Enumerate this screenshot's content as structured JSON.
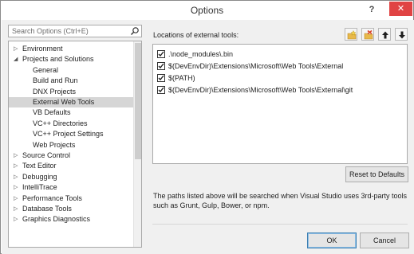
{
  "window": {
    "title": "Options",
    "help_label": "?",
    "close_label": "✕"
  },
  "search": {
    "placeholder": "Search Options (Ctrl+E)"
  },
  "tree": {
    "items": [
      {
        "label": "Environment",
        "expander": "▷"
      },
      {
        "label": "Projects and Solutions",
        "expander": "◢"
      },
      {
        "label": "General"
      },
      {
        "label": "Build and Run"
      },
      {
        "label": "DNX Projects"
      },
      {
        "label": "External Web Tools",
        "selected": true
      },
      {
        "label": "VB Defaults"
      },
      {
        "label": "VC++ Directories"
      },
      {
        "label": "VC++ Project Settings"
      },
      {
        "label": "Web Projects"
      },
      {
        "label": "Source Control",
        "expander": "▷"
      },
      {
        "label": "Text Editor",
        "expander": "▷"
      },
      {
        "label": "Debugging",
        "expander": "▷"
      },
      {
        "label": "IntelliTrace",
        "expander": "▷"
      },
      {
        "label": "Performance Tools",
        "expander": "▷"
      },
      {
        "label": "Database Tools",
        "expander": "▷"
      },
      {
        "label": "Graphics Diagnostics",
        "expander": "▷"
      }
    ]
  },
  "locations": {
    "label": "Locations of external tools:",
    "items": [
      {
        "path": ".\\node_modules\\.bin",
        "checked": true
      },
      {
        "path": "$(DevEnvDir)\\Extensions\\Microsoft\\Web Tools\\External",
        "checked": true
      },
      {
        "path": "$(PATH)",
        "checked": true
      },
      {
        "path": "$(DevEnvDir)\\Extensions\\Microsoft\\Web Tools\\External\\git",
        "checked": true
      }
    ]
  },
  "toolbar": {
    "icons": [
      "add-folder-icon",
      "remove-folder-icon",
      "move-up-icon",
      "move-down-icon"
    ]
  },
  "buttons": {
    "reset": "Reset to Defaults",
    "ok": "OK",
    "cancel": "Cancel"
  },
  "info_text": "The paths listed above will be searched when Visual Studio uses 3rd-party tools such as Grunt, Gulp, Bower, or npm.",
  "colors": {
    "close": "#e04343",
    "selected": "#d6d6d6",
    "folder": "#e8b94a",
    "remove": "#d9442b"
  }
}
